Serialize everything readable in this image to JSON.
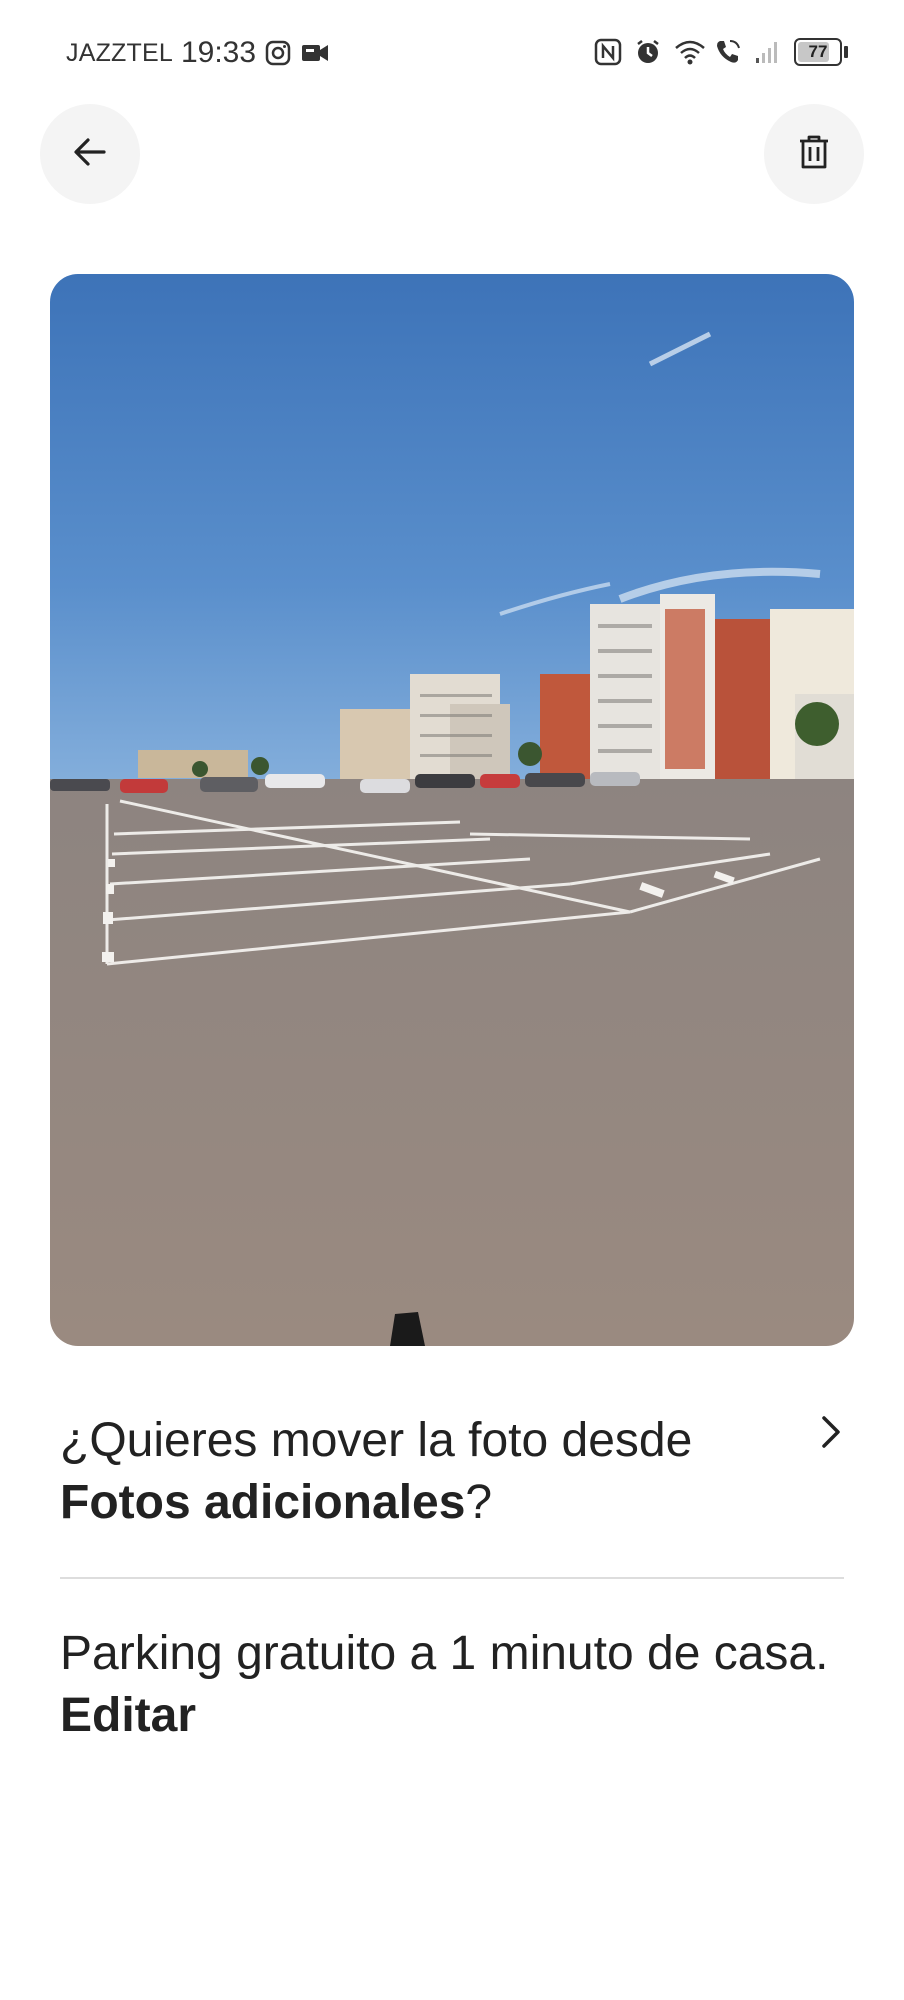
{
  "status_bar": {
    "carrier": "JAZZTEL",
    "time": "19:33",
    "left_icons": [
      "instagram-icon",
      "video-call-icon"
    ],
    "right_icons": [
      "nfc-icon",
      "alarm-icon",
      "wifi-icon",
      "wifi-calling-icon",
      "signal-icon"
    ],
    "battery_level": "77"
  },
  "toolbar": {
    "back_icon": "arrow-left-icon",
    "delete_icon": "trash-icon"
  },
  "photo": {
    "subject": "parking-lot-photo"
  },
  "move_prompt": {
    "text_before": "¿Quieres mover la foto desde",
    "bold_text": "Fotos adicionales",
    "text_after": "?",
    "icon": "chevron-right-icon"
  },
  "caption": {
    "text": "Parking gratuito a 1 minuto de casa.",
    "edit_label": "Editar"
  }
}
